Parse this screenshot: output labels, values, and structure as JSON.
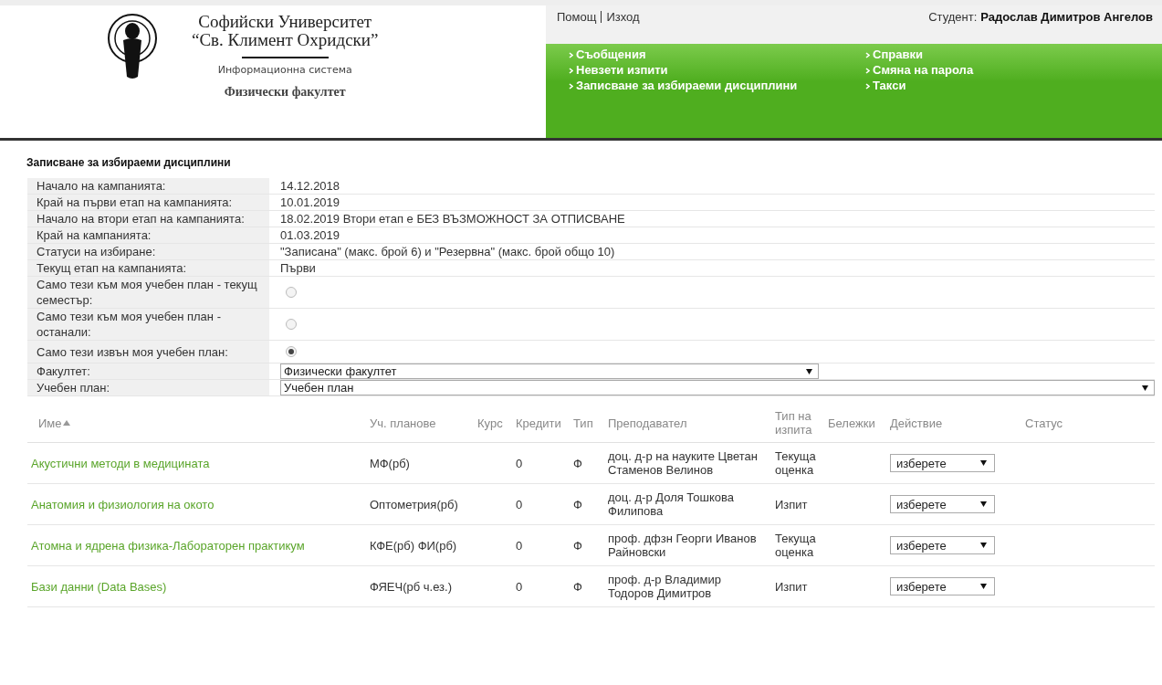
{
  "header": {
    "university_line1": "Софийски Университет",
    "university_line2": "“Св. Климент Охридски”",
    "system": "Информационна система",
    "faculty": "Физически факултет"
  },
  "top_bar": {
    "links": [
      "Помощ",
      "Изход"
    ],
    "student_label": "Студент:",
    "student_name": "Радослав Димитров Ангелов"
  },
  "menu": {
    "columns": [
      [
        "Съобщения",
        "Невзети изпити",
        "Записване за избираеми дисциплини"
      ],
      [
        "Справки",
        "Смяна на парола",
        "Такси"
      ]
    ]
  },
  "page_title": "Записване за избираеми дисциплини",
  "info": [
    {
      "kind": "text",
      "label": "Начало на кампанията:",
      "value": "14.12.2018"
    },
    {
      "kind": "text",
      "label": "Край на първи етап на кампанията:",
      "value": "10.01.2019"
    },
    {
      "kind": "text",
      "label": "Начало на втори етап на кампанията:",
      "value": "18.02.2019 Втори етап е БЕЗ ВЪЗМОЖНОСТ ЗА ОТПИСВАНЕ"
    },
    {
      "kind": "text",
      "label": "Край на кампанията:",
      "value": "01.03.2019"
    },
    {
      "kind": "text",
      "label": "Статуси на избиране:",
      "value": "\"Записана\" (макс. брой 6) и \"Резервна\" (макс. брой общо 10)"
    },
    {
      "kind": "text",
      "label": "Текущ етап на кампанията:",
      "value": "Първи"
    },
    {
      "kind": "radio",
      "label": "Само тези към моя учебен план - текущ семестър:",
      "selected": false
    },
    {
      "kind": "radio",
      "label": "Само тези към моя учебен план - останали:",
      "selected": false
    },
    {
      "kind": "radio",
      "label": "Само тези извън моя учебен план:",
      "selected": true
    },
    {
      "kind": "select",
      "label": "Факултет:",
      "value": "Физически факултет"
    },
    {
      "kind": "select",
      "label": "Учебен план:",
      "value": "Учебен план"
    }
  ],
  "table": {
    "columns": [
      {
        "label": "Име",
        "sorted": true
      },
      {
        "label": "Уч. планове",
        "sorted": false
      },
      {
        "label": "Курс",
        "sorted": false
      },
      {
        "label": "Кредити",
        "sorted": false
      },
      {
        "label": "Тип",
        "sorted": false
      },
      {
        "label": "Преподавател",
        "sorted": false
      },
      {
        "label": "Тип на изпита",
        "sorted": false
      },
      {
        "label": "Бележки",
        "sorted": false
      },
      {
        "label": "Действие",
        "sorted": false
      },
      {
        "label": "Статус",
        "sorted": false
      }
    ],
    "rows": [
      {
        "name": "Акустични методи в медицината",
        "plans": "МФ(рб)",
        "credits": "0",
        "type": "Ф",
        "teacher": "доц. д-р на науките Цветан Стаменов Велинов",
        "exam": "Текуща оценка",
        "action": "изберете"
      },
      {
        "name": "Анатомия и физиология на окото",
        "plans": "Оптометрия(рб)",
        "credits": "0",
        "type": "Ф",
        "teacher": "доц. д-р Доля Тошкова Филипова",
        "exam": "Изпит",
        "action": "изберете"
      },
      {
        "name": "Атомна и ядрена физика-Лабораторен практикум",
        "plans": "КФЕ(рб) ФИ(рб)",
        "credits": "0",
        "type": "Ф",
        "teacher": "проф. дфзн Георги Иванов Райновски",
        "exam": "Текуща оценка",
        "action": "изберете"
      },
      {
        "name": "Бази данни (Data Bases)",
        "plans": "ФЯЕЧ(рб ч.ез.)",
        "credits": "0",
        "type": "Ф",
        "teacher": "проф. д-р Владимир Тодоров Димитров",
        "exam": "Изпит",
        "action": "изберете"
      }
    ]
  }
}
